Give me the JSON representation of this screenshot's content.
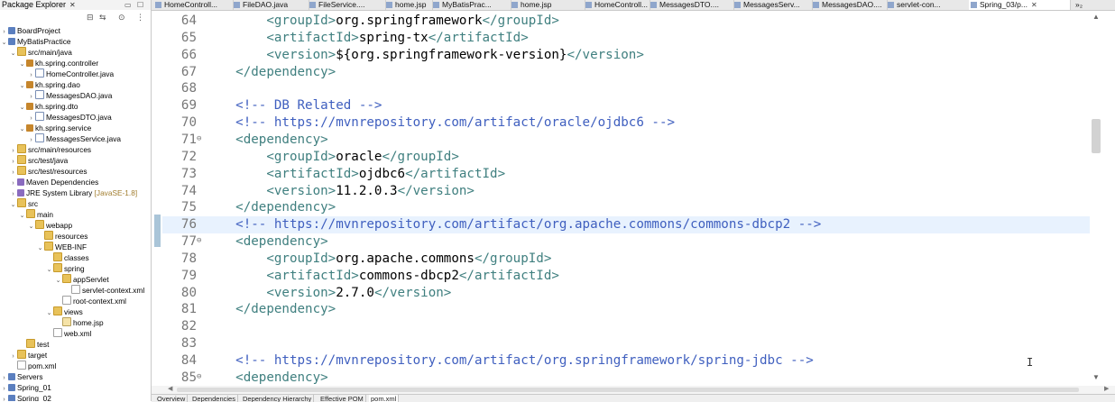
{
  "explorer": {
    "title": "Package Explorer",
    "close": "✕",
    "tree": [
      {
        "label": "BoardProject",
        "indent": 0,
        "arrow": "›",
        "icon": "project"
      },
      {
        "label": "MyBatisPractice",
        "indent": 0,
        "arrow": "⌄",
        "icon": "project"
      },
      {
        "label": "src/main/java",
        "indent": 1,
        "arrow": "⌄",
        "icon": "folder"
      },
      {
        "label": "kh.spring.controller",
        "indent": 2,
        "arrow": "⌄",
        "icon": "pkg"
      },
      {
        "label": "HomeController.java",
        "indent": 3,
        "arrow": "›",
        "icon": "java"
      },
      {
        "label": "kh.spring.dao",
        "indent": 2,
        "arrow": "⌄",
        "icon": "pkg"
      },
      {
        "label": "MessagesDAO.java",
        "indent": 3,
        "arrow": "›",
        "icon": "java"
      },
      {
        "label": "kh.spring.dto",
        "indent": 2,
        "arrow": "⌄",
        "icon": "pkg"
      },
      {
        "label": "MessagesDTO.java",
        "indent": 3,
        "arrow": "›",
        "icon": "java"
      },
      {
        "label": "kh.spring.service",
        "indent": 2,
        "arrow": "⌄",
        "icon": "pkg"
      },
      {
        "label": "MessagesService.java",
        "indent": 3,
        "arrow": "›",
        "icon": "java"
      },
      {
        "label": "src/main/resources",
        "indent": 1,
        "arrow": "›",
        "icon": "folder"
      },
      {
        "label": "src/test/java",
        "indent": 1,
        "arrow": "›",
        "icon": "folder"
      },
      {
        "label": "src/test/resources",
        "indent": 1,
        "arrow": "›",
        "icon": "folder"
      },
      {
        "label": "Maven Dependencies",
        "indent": 1,
        "arrow": "›",
        "icon": "lib"
      },
      {
        "label": "JRE System Library",
        "decor": "[JavaSE-1.8]",
        "indent": 1,
        "arrow": "›",
        "icon": "lib"
      },
      {
        "label": "src",
        "indent": 1,
        "arrow": "⌄",
        "icon": "folder"
      },
      {
        "label": "main",
        "indent": 2,
        "arrow": "⌄",
        "icon": "folder"
      },
      {
        "label": "webapp",
        "indent": 3,
        "arrow": "⌄",
        "icon": "folder"
      },
      {
        "label": "resources",
        "indent": 4,
        "arrow": "",
        "icon": "folder"
      },
      {
        "label": "WEB-INF",
        "indent": 4,
        "arrow": "⌄",
        "icon": "folder"
      },
      {
        "label": "classes",
        "indent": 5,
        "arrow": "",
        "icon": "folder"
      },
      {
        "label": "spring",
        "indent": 5,
        "arrow": "⌄",
        "icon": "folder"
      },
      {
        "label": "appServlet",
        "indent": 6,
        "arrow": "⌄",
        "icon": "folder"
      },
      {
        "label": "servlet-context.xml",
        "indent": 7,
        "arrow": "",
        "icon": "xml"
      },
      {
        "label": "root-context.xml",
        "indent": 6,
        "arrow": "",
        "icon": "xml"
      },
      {
        "label": "views",
        "indent": 5,
        "arrow": "⌄",
        "icon": "folder"
      },
      {
        "label": "home.jsp",
        "indent": 6,
        "arrow": "",
        "icon": "jsp"
      },
      {
        "label": "web.xml",
        "indent": 5,
        "arrow": "",
        "icon": "xml"
      },
      {
        "label": "test",
        "indent": 2,
        "arrow": "",
        "icon": "folder"
      },
      {
        "label": "target",
        "indent": 1,
        "arrow": "›",
        "icon": "folder"
      },
      {
        "label": "pom.xml",
        "indent": 1,
        "arrow": "",
        "icon": "xml"
      },
      {
        "label": "Servers",
        "indent": 0,
        "arrow": "›",
        "icon": "project"
      },
      {
        "label": "Spring_01",
        "indent": 0,
        "arrow": "›",
        "icon": "project"
      },
      {
        "label": "Spring_02",
        "indent": 0,
        "arrow": "›",
        "icon": "project"
      }
    ]
  },
  "tabs": [
    {
      "label": "HomeControll...",
      "active": false
    },
    {
      "label": "FileDAO.java",
      "active": false
    },
    {
      "label": "FileService....",
      "active": false
    },
    {
      "label": "home.jsp",
      "active": false
    },
    {
      "label": "MyBatisPrac...",
      "active": false
    },
    {
      "label": "home.jsp",
      "active": false
    },
    {
      "label": "HomeControll...",
      "active": false
    },
    {
      "label": "MessagesDTO....",
      "active": false
    },
    {
      "label": "MessagesServ...",
      "active": false
    },
    {
      "label": "MessagesDAO....",
      "active": false
    },
    {
      "label": "servlet-con...",
      "active": false
    },
    {
      "label": "Spring_03/p...",
      "active": true
    }
  ],
  "tab_overflow": "»₂",
  "editor": {
    "current_line": 76,
    "lines": [
      {
        "num": "64",
        "fold": "",
        "type": "elem",
        "indent": "        ",
        "tag": "groupId",
        "text": "org.springframework"
      },
      {
        "num": "65",
        "fold": "",
        "type": "elem",
        "indent": "        ",
        "tag": "artifactId",
        "text": "spring-tx"
      },
      {
        "num": "66",
        "fold": "",
        "type": "elem",
        "indent": "        ",
        "tag": "version",
        "text": "${org.springframework-version}"
      },
      {
        "num": "67",
        "fold": "",
        "type": "close",
        "indent": "    ",
        "tag": "dependency"
      },
      {
        "num": "68",
        "fold": "",
        "type": "blank"
      },
      {
        "num": "69",
        "fold": "",
        "type": "comment",
        "indent": "    ",
        "text": "<!-- DB Related -->"
      },
      {
        "num": "70",
        "fold": "",
        "type": "comment",
        "indent": "    ",
        "text": "<!-- https://mvnrepository.com/artifact/oracle/ojdbc6 -->"
      },
      {
        "num": "71",
        "fold": "⊖",
        "type": "open",
        "indent": "    ",
        "tag": "dependency"
      },
      {
        "num": "72",
        "fold": "",
        "type": "elem",
        "indent": "        ",
        "tag": "groupId",
        "text": "oracle"
      },
      {
        "num": "73",
        "fold": "",
        "type": "elem",
        "indent": "        ",
        "tag": "artifactId",
        "text": "ojdbc6"
      },
      {
        "num": "74",
        "fold": "",
        "type": "elem",
        "indent": "        ",
        "tag": "version",
        "text": "11.2.0.3"
      },
      {
        "num": "75",
        "fold": "",
        "type": "close",
        "indent": "    ",
        "tag": "dependency"
      },
      {
        "num": "76",
        "fold": "",
        "type": "comment",
        "indent": "    ",
        "text": "<!-- https://mvnrepository.com/artifact/org.apache.commons/commons-dbcp2 -->"
      },
      {
        "num": "77",
        "fold": "⊖",
        "type": "open",
        "indent": "    ",
        "tag": "dependency"
      },
      {
        "num": "78",
        "fold": "",
        "type": "elem",
        "indent": "        ",
        "tag": "groupId",
        "text": "org.apache.commons"
      },
      {
        "num": "79",
        "fold": "",
        "type": "elem",
        "indent": "        ",
        "tag": "artifactId",
        "text": "commons-dbcp2"
      },
      {
        "num": "80",
        "fold": "",
        "type": "elem",
        "indent": "        ",
        "tag": "version",
        "text": "2.7.0"
      },
      {
        "num": "81",
        "fold": "",
        "type": "close",
        "indent": "    ",
        "tag": "dependency"
      },
      {
        "num": "82",
        "fold": "",
        "type": "blank"
      },
      {
        "num": "83",
        "fold": "",
        "type": "blank"
      },
      {
        "num": "84",
        "fold": "",
        "type": "comment",
        "indent": "    ",
        "text": "<!-- https://mvnrepository.com/artifact/org.springframework/spring-jdbc -->"
      },
      {
        "num": "85",
        "fold": "⊖",
        "type": "open",
        "indent": "    ",
        "tag": "dependency"
      }
    ]
  },
  "bottom_tabs": [
    {
      "label": "Overview",
      "active": false
    },
    {
      "label": "Dependencies",
      "active": false
    },
    {
      "label": "Dependency Hierarchy",
      "active": false
    },
    {
      "label": "Effective POM",
      "active": false
    },
    {
      "label": "pom.xml",
      "active": true
    }
  ]
}
